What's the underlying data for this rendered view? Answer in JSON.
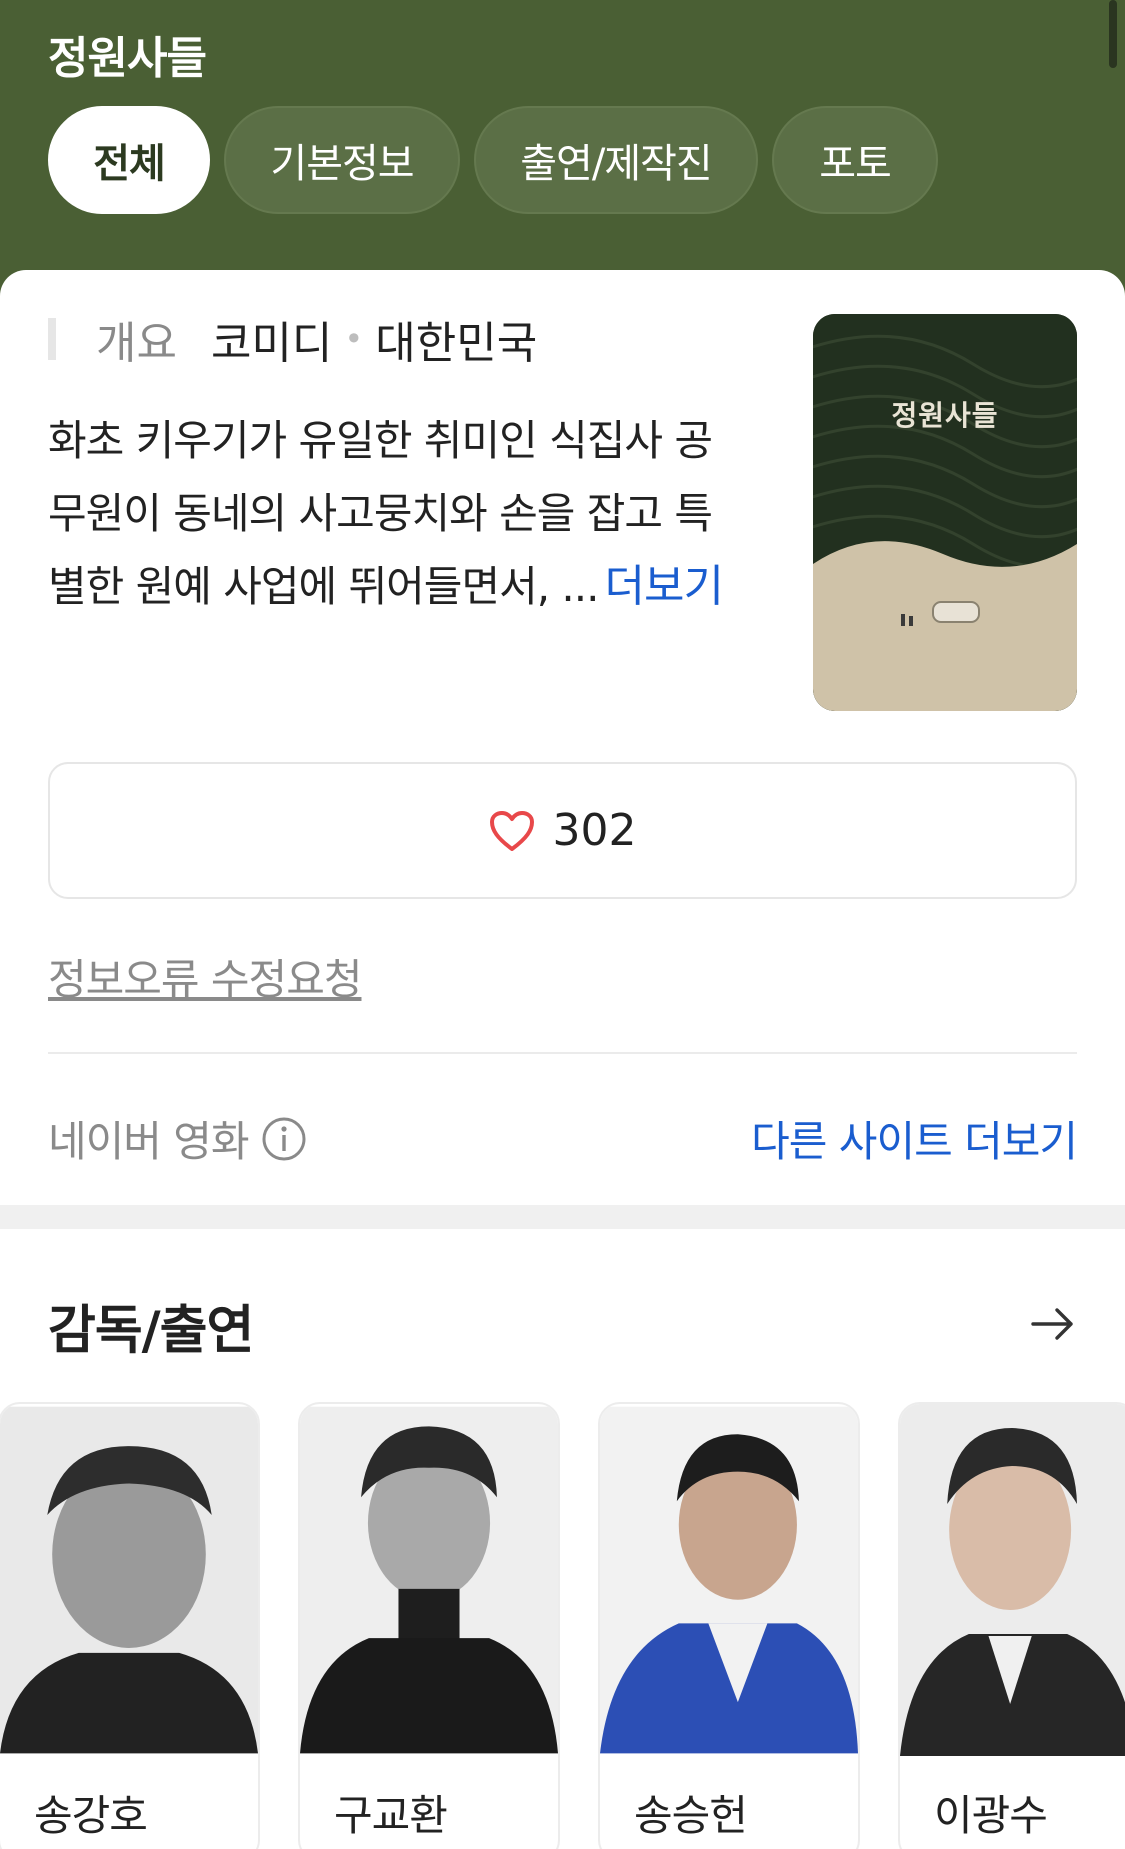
{
  "header": {
    "title": "정원사들",
    "tabs": [
      {
        "label": "전체",
        "active": true
      },
      {
        "label": "기본정보",
        "active": false
      },
      {
        "label": "출연/제작진",
        "active": false
      },
      {
        "label": "포토",
        "active": false
      }
    ]
  },
  "overview": {
    "label": "개요",
    "genre": "코미디",
    "country": "대한민국",
    "synopsis_lines": [
      "화초 키우기가 유일한 취미인 식집사 공",
      "무원이 동네의 사고뭉치와 손을 잡고 특",
      "별한 원예 사업에 뛰어들면서, ..."
    ],
    "more_label": "더보기",
    "poster_title": "정원사들"
  },
  "like": {
    "count": "302",
    "icon": "heart-icon"
  },
  "report_label": "정보오류 수정요청",
  "source": {
    "label": "네이버 영화",
    "icon": "info-icon",
    "other_sites_label": "다른 사이트 더보기"
  },
  "cast_section": {
    "title": "감독/출연",
    "arrow_icon": "arrow-right-icon",
    "members": [
      {
        "name": "송강호"
      },
      {
        "name": "구교환"
      },
      {
        "name": "송승헌"
      },
      {
        "name": "이광수"
      }
    ]
  },
  "colors": {
    "header_bg": "#4a5f34",
    "accent_blue": "#1a5dcf",
    "heart_red": "#e8484a"
  }
}
